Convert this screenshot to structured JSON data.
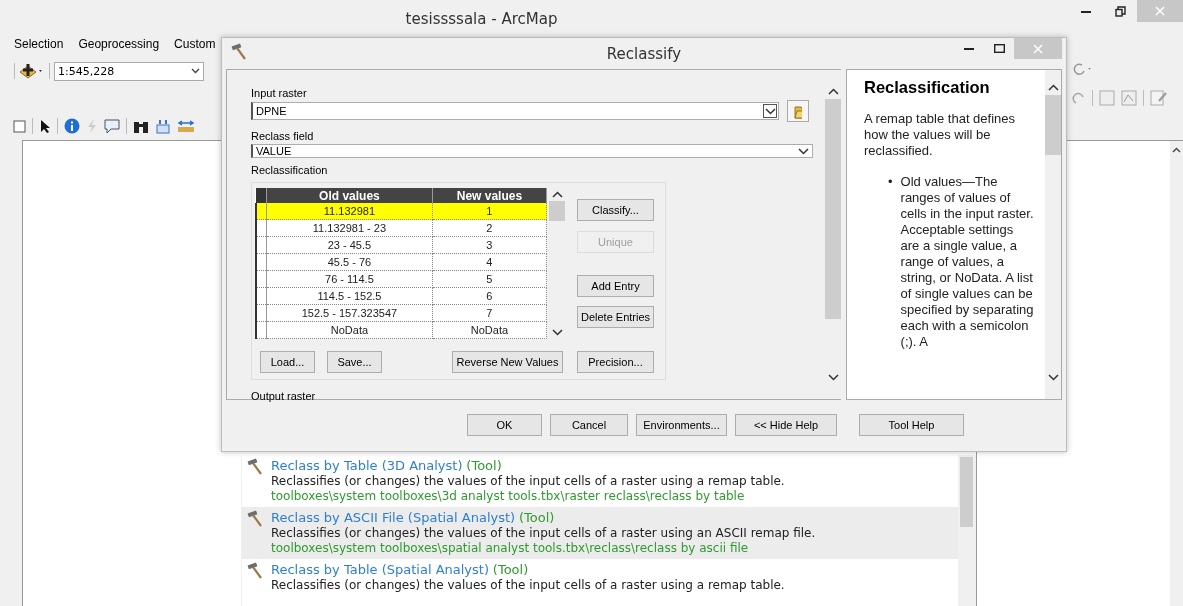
{
  "app": {
    "title": "tesissssala - ArcMap",
    "menu": [
      "Selection",
      "Geoprocessing",
      "Custom"
    ],
    "scale": "1:545,228"
  },
  "dialog": {
    "title": "Reclassify",
    "input_raster": {
      "label": "Input raster",
      "value": "DPNE"
    },
    "reclass_field": {
      "label": "Reclass field",
      "value": "VALUE"
    },
    "reclassification": {
      "label": "Reclassification",
      "columns": [
        "Old values",
        "New values"
      ],
      "rows": [
        {
          "old": "11.132981",
          "new": "1",
          "selected": true
        },
        {
          "old": "11.132981 - 23",
          "new": "2",
          "selected": false
        },
        {
          "old": "23 - 45.5",
          "new": "3",
          "selected": false
        },
        {
          "old": "45.5 - 76",
          "new": "4",
          "selected": false
        },
        {
          "old": "76 - 114.5",
          "new": "5",
          "selected": false
        },
        {
          "old": "114.5 - 152.5",
          "new": "6",
          "selected": false
        },
        {
          "old": "152.5 - 157.323547",
          "new": "7",
          "selected": false
        },
        {
          "old": "NoData",
          "new": "NoData",
          "selected": false
        }
      ],
      "side_buttons": [
        {
          "label": "Classify...",
          "disabled": false
        },
        {
          "label": "Unique",
          "disabled": true
        },
        {
          "label": "Add Entry",
          "disabled": false
        },
        {
          "label": "Delete Entries",
          "disabled": false
        }
      ],
      "bottom_buttons": [
        "Load...",
        "Save...",
        "Reverse New Values",
        "Precision..."
      ]
    },
    "output_raster": {
      "label": "Output raster"
    },
    "help": {
      "title": "Reclassification",
      "intro": "A remap table that defines how the values will be reclassified.",
      "bullets": [
        {
          "marker": "•",
          "text": "Old values—The ranges of values of cells in the input raster. Acceptable settings are a single value, a range of values, a string, or NoData. A list of single values can be specified by separating each with a semicolon (;). A"
        }
      ]
    },
    "footer_buttons": [
      "OK",
      "Cancel",
      "Environments...",
      "<< Hide Help",
      "Tool Help"
    ]
  },
  "results": [
    {
      "title": "Reclass by Table (3D Analyst)",
      "type": "(Tool)",
      "description": "Reclassifies (or changes) the values of the input cells of a raster using a remap table.",
      "path": "toolboxes\\system toolboxes\\3d analyst tools.tbx\\raster reclass\\reclass by table",
      "selected": false
    },
    {
      "title": "Reclass by ASCII File (Spatial Analyst)",
      "type": "(Tool)",
      "description": "Reclassifies (or changes) the values of the input cells of a raster using an ASCII remap file.",
      "path": "toolboxes\\system toolboxes\\spatial analyst tools.tbx\\reclass\\reclass by ascii file",
      "selected": true
    },
    {
      "title": "Reclass by Table (Spatial Analyst)",
      "type": "(Tool)",
      "description": "Reclassifies (or changes) the values of the input cells of a raster using a remap table.",
      "selected": false
    }
  ]
}
